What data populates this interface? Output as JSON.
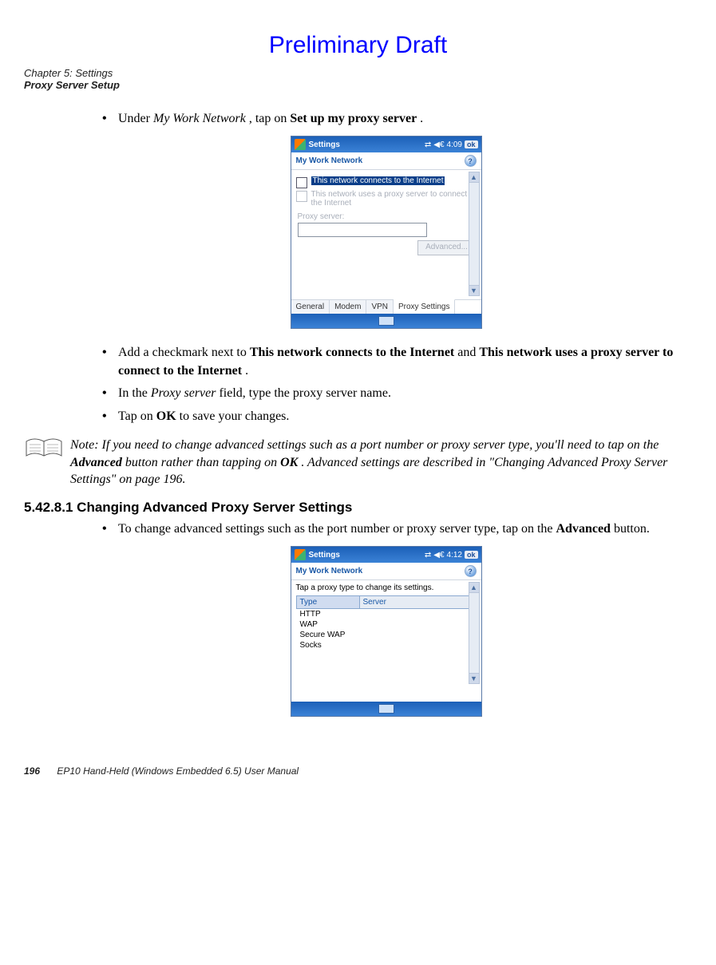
{
  "doc": {
    "preliminary": "Preliminary Draft",
    "chapter": "Chapter 5: Settings",
    "section": "Proxy Server Setup",
    "page_number": "196",
    "manual_title": "EP10 Hand-Held (Windows Embedded 6.5) User Manual"
  },
  "steps": {
    "s1_pre": "Under ",
    "s1_em": "My Work Network",
    "s1_mid": ", tap on ",
    "s1_bold": "Set up my proxy server",
    "s1_post": ".",
    "s2_pre": "Add a checkmark next to ",
    "s2_b1": "This network connects to the Internet",
    "s2_mid": " and ",
    "s2_b2": "This network uses a proxy server to connect to the Internet",
    "s2_post": ".",
    "s3_pre": "In the ",
    "s3_em": "Proxy server",
    "s3_post": " field, type the proxy server name.",
    "s4_pre": "Tap on ",
    "s4_b": "OK",
    "s4_post": " to save your changes."
  },
  "note": {
    "label": "Note:",
    "t1": " If you need to change advanced settings such as a port number or proxy server type, you'll need to tap on the ",
    "b1": "Advanced",
    "t2": " button rather than tapping on ",
    "b2": "OK",
    "t3": ". Advanced settings are described in \"Changing Advanced Proxy Server Settings\" on page 196."
  },
  "subsection": {
    "num_title": "5.42.8.1 Changing Advanced Proxy Server Settings",
    "bullet_pre": "To change advanced settings such as the port number or proxy server type, tap on the ",
    "bullet_b": "Advanced",
    "bullet_post": " button."
  },
  "mock1": {
    "titlebar": "Settings",
    "time": "4:09",
    "ok": "ok",
    "subheader": "My Work Network",
    "help": "?",
    "cb1": "This network connects to the Internet",
    "cb2": "This network uses a proxy server to connect to the Internet",
    "proxy_label": "Proxy server:",
    "adv": "Advanced...",
    "tabs": {
      "t1": "General",
      "t2": "Modem",
      "t3": "VPN",
      "t4": "Proxy Settings"
    }
  },
  "mock2": {
    "titlebar": "Settings",
    "time": "4:12",
    "ok": "ok",
    "subheader": "My Work Network",
    "help": "?",
    "instruction": "Tap a proxy type to change its settings.",
    "col1": "Type",
    "col2": "Server",
    "rows": [
      "HTTP",
      "WAP",
      "Secure WAP",
      "Socks"
    ]
  }
}
